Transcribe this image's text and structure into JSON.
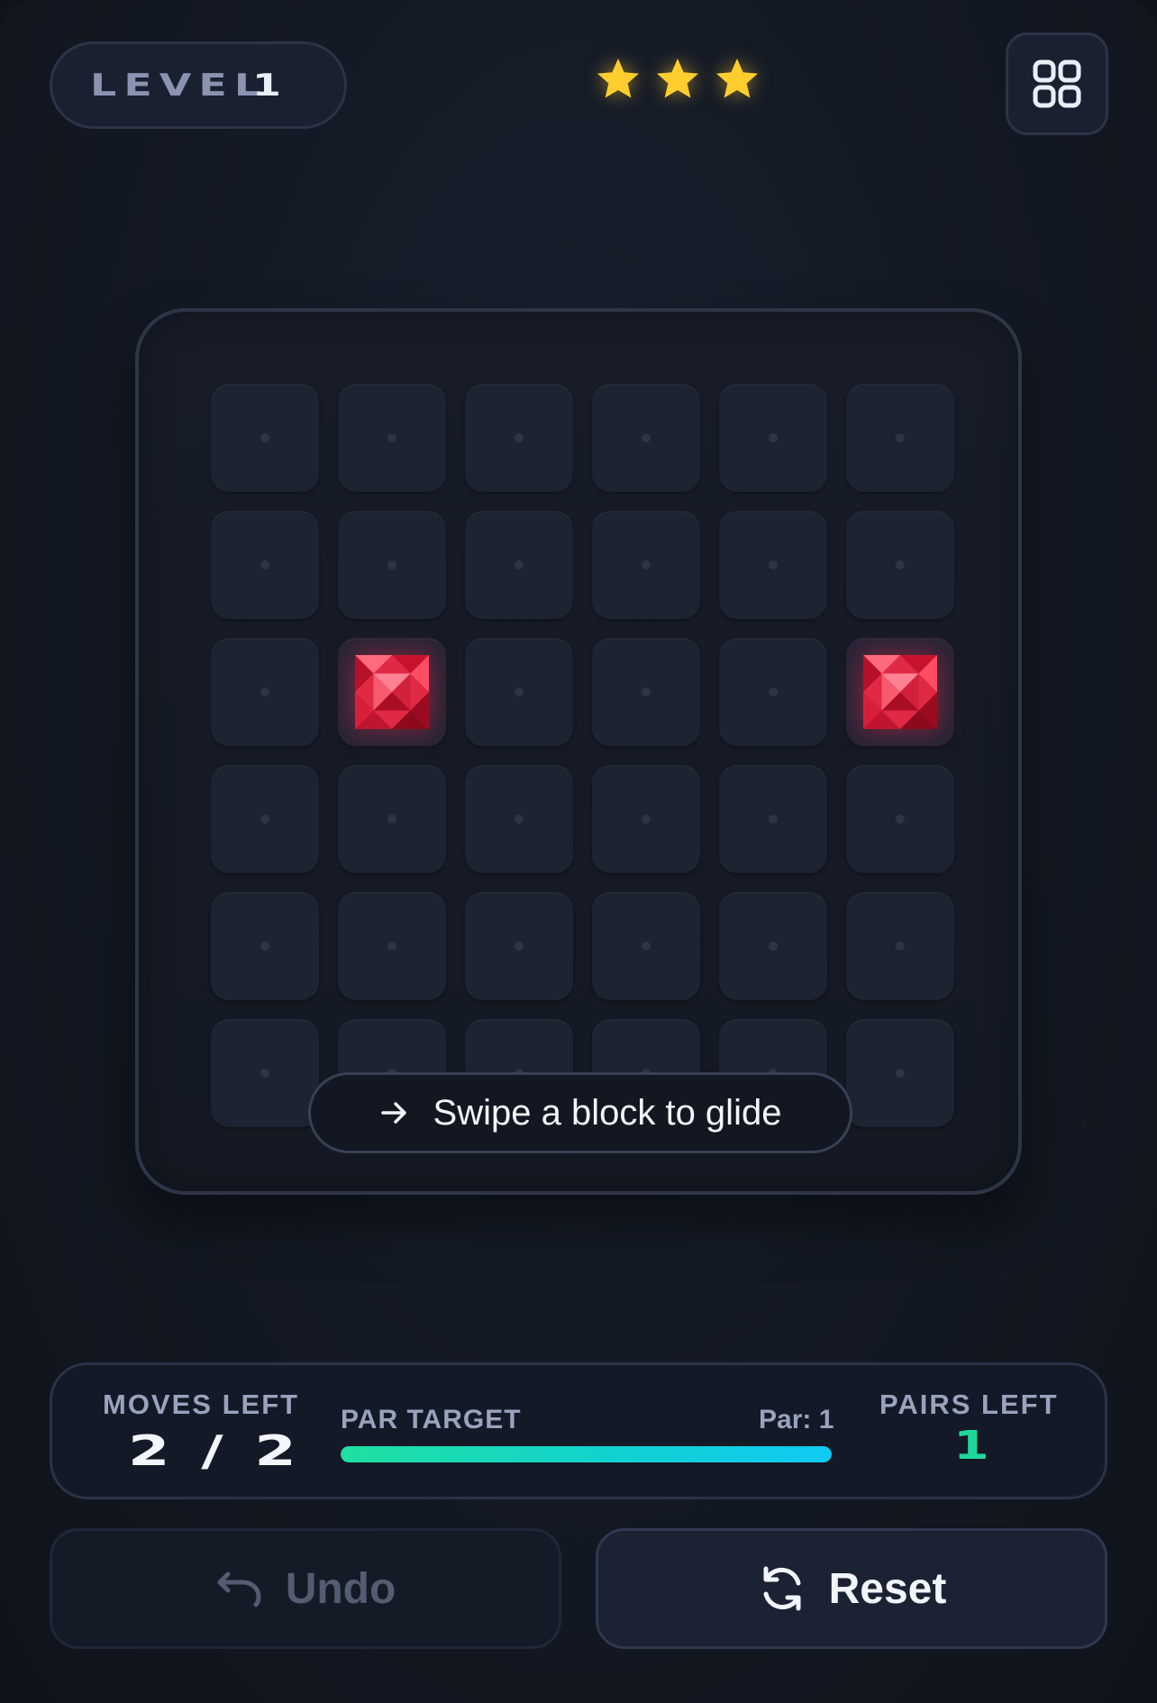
{
  "header": {
    "level_label": "LEVEL",
    "level_number": "1",
    "stars_earned": 3,
    "stars_total": 3,
    "menu_icon": "grid-menu-icon"
  },
  "board": {
    "rows": 6,
    "cols": 6,
    "gems": [
      {
        "row": 3,
        "col": 2,
        "color": "#e02a45"
      },
      {
        "row": 3,
        "col": 6,
        "color": "#e02a45"
      }
    ],
    "hint_icon": "arrow-right-icon",
    "hint_text": "Swipe a block to glide"
  },
  "stats": {
    "moves_label": "MOVES LEFT",
    "moves_value": "2 / 2",
    "par_label": "PAR TARGET",
    "par_value": "Par: 1",
    "par_progress": 1.0,
    "pairs_label": "PAIRS LEFT",
    "pairs_value": "1"
  },
  "actions": {
    "undo_label": "Undo",
    "undo_icon": "undo-icon",
    "undo_enabled": false,
    "reset_label": "Reset",
    "reset_icon": "refresh-icon"
  },
  "colors": {
    "star": "#ffce2e",
    "gem": "#e02a45",
    "progress_start": "#1fe0a0",
    "progress_end": "#11c9f2",
    "pairs_accent": "#1fd79a"
  }
}
